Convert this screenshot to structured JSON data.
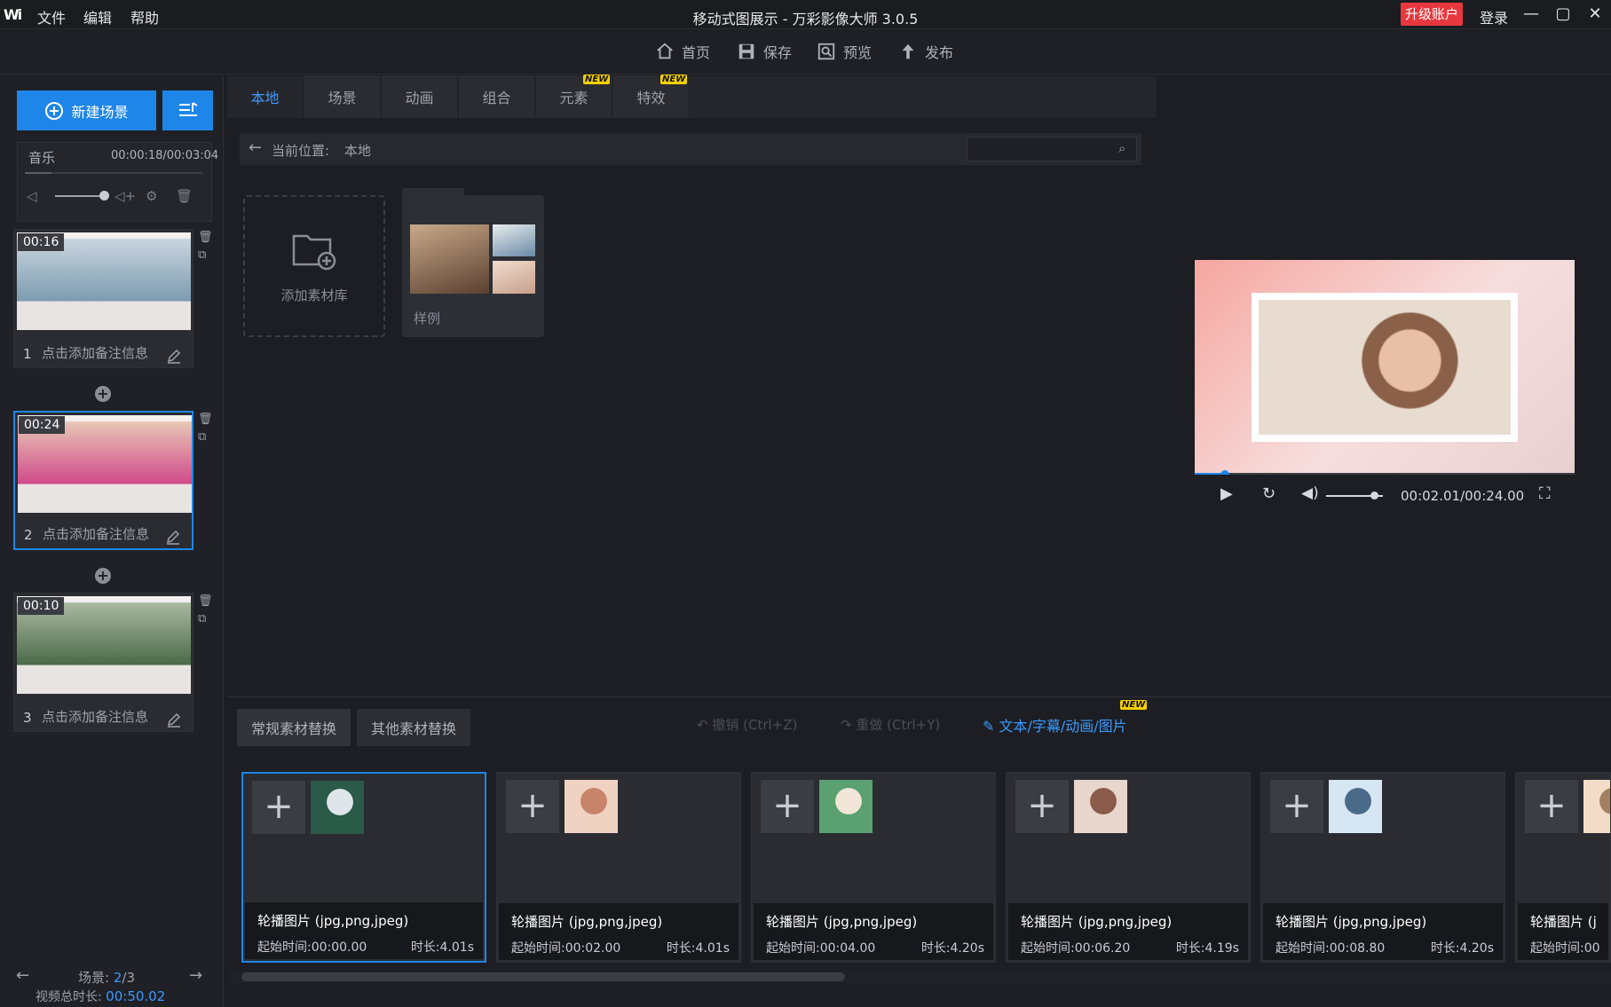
{
  "app": {
    "logo": "Wi",
    "title": "移动式图展示 - 万彩影像大师 3.0.5",
    "menu": [
      "文件",
      "编辑",
      "帮助"
    ],
    "upgrade": "升级账户",
    "login": "登录"
  },
  "toolbar": [
    {
      "label": "首页",
      "icon": "home-icon"
    },
    {
      "label": "保存",
      "icon": "save-icon"
    },
    {
      "label": "预览",
      "icon": "preview-icon"
    },
    {
      "label": "发布",
      "icon": "publish-icon"
    }
  ],
  "left": {
    "new_scene": "新建场景",
    "music_label": "音乐",
    "music_time": "00:00:18/00:03:04",
    "scenes": [
      {
        "index": "1",
        "duration": "00:16",
        "note": "点击添加备注信息",
        "colors": [
          "#c8d4de",
          "#7d9cb0"
        ]
      },
      {
        "index": "2",
        "duration": "00:24",
        "note": "点击添加备注信息",
        "colors": [
          "#e8c6b6",
          "#d04a8a"
        ]
      },
      {
        "index": "3",
        "duration": "00:10",
        "note": "点击添加备注信息",
        "colors": [
          "#a8b8a0",
          "#4c6a4a"
        ]
      }
    ],
    "footer_scene_label": "场景:",
    "footer_scene_current": "2",
    "footer_scene_total": "/3",
    "footer_total_label": "视频总时长:",
    "footer_total_value": "00:50.02"
  },
  "tabs": [
    {
      "label": "本地",
      "active": true,
      "new": false
    },
    {
      "label": "场景",
      "active": false,
      "new": false
    },
    {
      "label": "动画",
      "active": false,
      "new": false
    },
    {
      "label": "组合",
      "active": false,
      "new": false
    },
    {
      "label": "元素",
      "active": false,
      "new": true
    },
    {
      "label": "特效",
      "active": false,
      "new": true
    }
  ],
  "new_badge": "NEW",
  "library": {
    "path_label": "当前位置:",
    "path_value": "本地",
    "search_placeholder": "",
    "add_library": "添加素材库",
    "folder_name": "样例"
  },
  "preview": {
    "time": "00:02.01/00:24.00",
    "progress": 0.08,
    "volume": 0.85
  },
  "replace": {
    "tab_common": "常规素材替换",
    "tab_other": "其他素材替换",
    "undo": "撤销 (Ctrl+Z)",
    "redo": "重做 (Ctrl+Y)",
    "text_link": "文本/字幕/动画/图片",
    "cards": [
      {
        "title": "轮播图片 (jpg,png,jpeg)",
        "start": "起始时间:00:00.00",
        "duration": "时长:4.01s",
        "colors": [
          "#2a5a48",
          "#dfe6ea"
        ]
      },
      {
        "title": "轮播图片 (jpg,png,jpeg)",
        "start": "起始时间:00:02.00",
        "duration": "时长:4.01s",
        "colors": [
          "#f0d2c2",
          "#c8846a"
        ]
      },
      {
        "title": "轮播图片 (jpg,png,jpeg)",
        "start": "起始时间:00:04.00",
        "duration": "时长:4.20s",
        "colors": [
          "#5aa070",
          "#f2e6d8"
        ]
      },
      {
        "title": "轮播图片 (jpg,png,jpeg)",
        "start": "起始时间:00:06.20",
        "duration": "时长:4.19s",
        "colors": [
          "#e8d6cc",
          "#8a5a4a"
        ]
      },
      {
        "title": "轮播图片 (jpg,png,jpeg)",
        "start": "起始时间:00:08.80",
        "duration": "时长:4.20s",
        "colors": [
          "#d6e6f2",
          "#4a6a8a"
        ]
      },
      {
        "title": "轮播图片 (j",
        "start": "起始时间:00",
        "duration": "",
        "colors": [
          "#f2dcc8",
          "#a08060"
        ]
      }
    ]
  },
  "colors": {
    "accent": "#1e86e8",
    "danger": "#e8383d",
    "link": "#3c99ff"
  }
}
